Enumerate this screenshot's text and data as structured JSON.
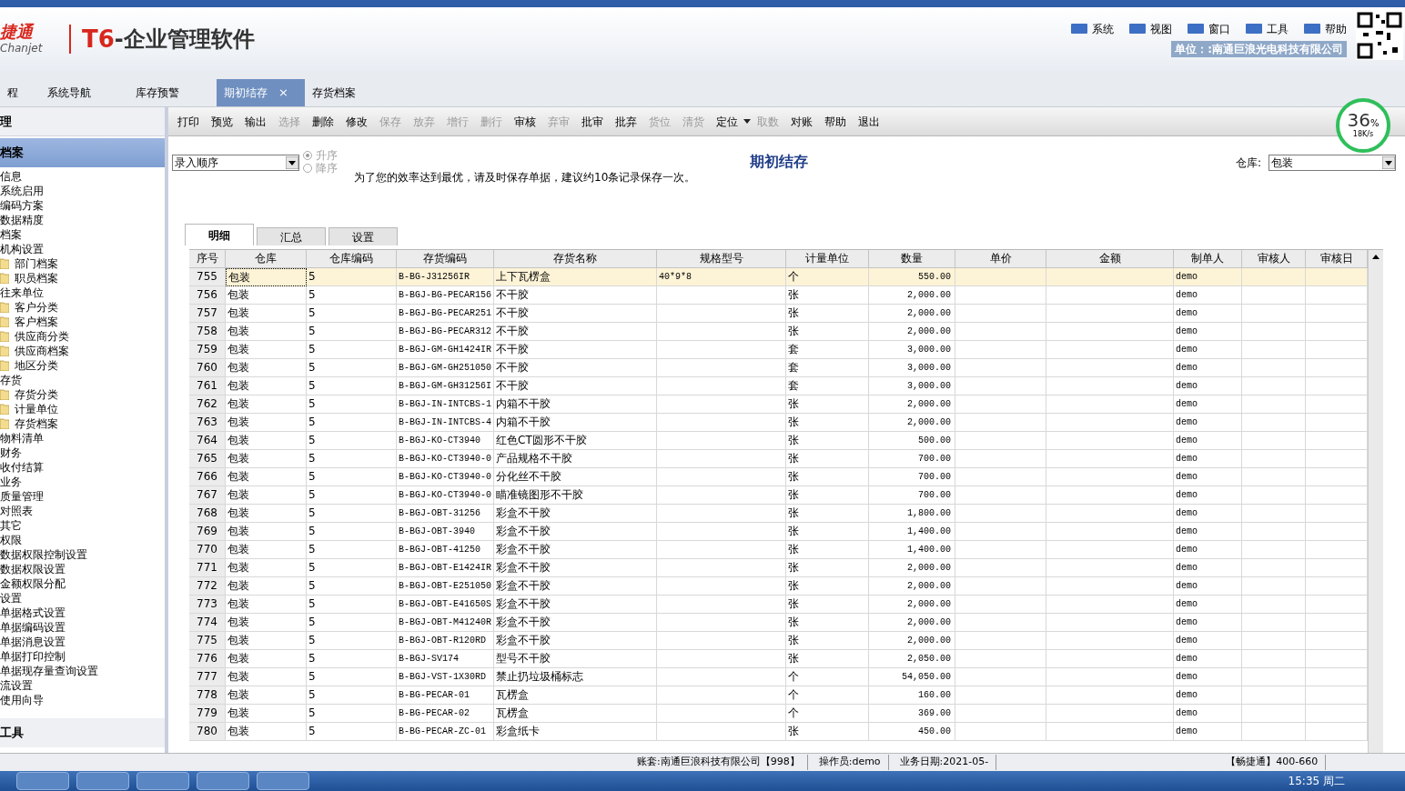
{
  "header": {
    "brand_cn": "捷通",
    "brand_en": "Chanjet",
    "product_mark": "T6",
    "product_title": "-企业管理软件",
    "menu": [
      "系统",
      "视图",
      "窗口",
      "工具",
      "帮助"
    ],
    "unit": "单位：:南通巨浪光电科技有限公司"
  },
  "tabs": [
    {
      "label": "程",
      "selected": false
    },
    {
      "label": "系统导航",
      "selected": false
    },
    {
      "label": "库存预警",
      "selected": false
    },
    {
      "label": "期初结存",
      "selected": true,
      "close": "×"
    },
    {
      "label": "存货档案",
      "selected": false
    }
  ],
  "sidebar": {
    "top": "理",
    "section": "档案",
    "bottom": "工具",
    "items": [
      {
        "label": "信息",
        "folder": false
      },
      {
        "label": "系统启用",
        "folder": false
      },
      {
        "label": "编码方案",
        "folder": false
      },
      {
        "label": "数据精度",
        "folder": false
      },
      {
        "label": "档案",
        "folder": false
      },
      {
        "label": "机构设置",
        "folder": false,
        "children": [
          {
            "label": "部门档案",
            "folder": true
          },
          {
            "label": "职员档案",
            "folder": true
          }
        ]
      },
      {
        "label": "往来单位",
        "folder": false,
        "children": [
          {
            "label": "客户分类",
            "folder": true
          },
          {
            "label": "客户档案",
            "folder": true
          },
          {
            "label": "供应商分类",
            "folder": true
          },
          {
            "label": "供应商档案",
            "folder": true
          },
          {
            "label": "地区分类",
            "folder": true
          }
        ]
      },
      {
        "label": "存货",
        "folder": false,
        "children": [
          {
            "label": "存货分类",
            "folder": true
          },
          {
            "label": "计量单位",
            "folder": true
          },
          {
            "label": "存货档案",
            "folder": true
          }
        ]
      },
      {
        "label": "物料清单",
        "folder": false
      },
      {
        "label": "财务",
        "folder": false
      },
      {
        "label": "收付结算",
        "folder": false
      },
      {
        "label": "业务",
        "folder": false
      },
      {
        "label": "质量管理",
        "folder": false
      },
      {
        "label": "对照表",
        "folder": false
      },
      {
        "label": "其它",
        "folder": false
      },
      {
        "label": "权限",
        "folder": false
      },
      {
        "label": "数据权限控制设置",
        "folder": false
      },
      {
        "label": "数据权限设置",
        "folder": false
      },
      {
        "label": "金额权限分配",
        "folder": false
      },
      {
        "label": "设置",
        "folder": false
      },
      {
        "label": "单据格式设置",
        "folder": false
      },
      {
        "label": "单据编码设置",
        "folder": false
      },
      {
        "label": "单据消息设置",
        "folder": false
      },
      {
        "label": "单据打印控制",
        "folder": false
      },
      {
        "label": "单据现存量查询设置",
        "folder": false
      },
      {
        "label": "流设置",
        "folder": false
      },
      {
        "label": "使用向导",
        "folder": false
      }
    ]
  },
  "toolbar": [
    {
      "label": "打印",
      "disabled": false
    },
    {
      "label": "预览",
      "disabled": false
    },
    {
      "label": "输出",
      "disabled": false
    },
    {
      "label": "选择",
      "disabled": true
    },
    {
      "label": "删除",
      "disabled": false
    },
    {
      "label": "修改",
      "disabled": false
    },
    {
      "label": "保存",
      "disabled": true
    },
    {
      "label": "放弃",
      "disabled": true
    },
    {
      "label": "增行",
      "disabled": true
    },
    {
      "label": "删行",
      "disabled": true
    },
    {
      "label": "审核",
      "disabled": false
    },
    {
      "label": "弃审",
      "disabled": true
    },
    {
      "label": "批审",
      "disabled": false
    },
    {
      "label": "批弃",
      "disabled": false
    },
    {
      "label": "货位",
      "disabled": true
    },
    {
      "label": "清货",
      "disabled": true
    },
    {
      "label": "定位",
      "disabled": false,
      "dropdown": true
    },
    {
      "label": "取数",
      "disabled": true
    },
    {
      "label": "对账",
      "disabled": false
    },
    {
      "label": "帮助",
      "disabled": false
    },
    {
      "label": "退出",
      "disabled": false
    }
  ],
  "network": {
    "percent": "36",
    "unit": "%",
    "speed": "18K/s"
  },
  "form": {
    "sort": "录入顺序",
    "order": [
      {
        "label": "升序",
        "selected": true
      },
      {
        "label": "降序",
        "selected": false
      }
    ],
    "hint": "为了您的效率达到最优，请及时保存单据，建议约10条记录保存一次。",
    "title": "期初结存",
    "warehouse_label": "仓库:",
    "warehouse": "包装"
  },
  "subtabs": [
    {
      "label": "明细",
      "selected": true
    },
    {
      "label": "汇总",
      "selected": false
    },
    {
      "label": "设置",
      "selected": false
    }
  ],
  "table": {
    "columns": [
      "序号",
      "仓库",
      "仓库编码",
      "存货编码",
      "存货名称",
      "规格型号",
      "计量单位",
      "数量",
      "单价",
      "金额",
      "制单人",
      "审核人",
      "审核日"
    ],
    "rows": [
      {
        "selected": true,
        "cells": [
          "755",
          "包装",
          "5",
          "B-BG-J31256IR",
          "上下瓦楞盒",
          "40*9*8",
          "个",
          "550.00",
          "",
          "",
          "demo",
          "",
          ""
        ]
      },
      {
        "selected": false,
        "cells": [
          "756",
          "包装",
          "5",
          "B-BGJ-BG-PECAR156",
          "不干胶",
          "",
          "张",
          "2,000.00",
          "",
          "",
          "demo",
          "",
          ""
        ]
      },
      {
        "selected": false,
        "cells": [
          "757",
          "包装",
          "5",
          "B-BGJ-BG-PECAR251",
          "不干胶",
          "",
          "张",
          "2,000.00",
          "",
          "",
          "demo",
          "",
          ""
        ]
      },
      {
        "selected": false,
        "cells": [
          "758",
          "包装",
          "5",
          "B-BGJ-BG-PECAR312",
          "不干胶",
          "",
          "张",
          "2,000.00",
          "",
          "",
          "demo",
          "",
          ""
        ]
      },
      {
        "selected": false,
        "cells": [
          "759",
          "包装",
          "5",
          "B-BGJ-GM-GH1424IR",
          "不干胶",
          "",
          "套",
          "3,000.00",
          "",
          "",
          "demo",
          "",
          ""
        ]
      },
      {
        "selected": false,
        "cells": [
          "760",
          "包装",
          "5",
          "B-BGJ-GM-GH251050",
          "不干胶",
          "",
          "套",
          "3,000.00",
          "",
          "",
          "demo",
          "",
          ""
        ]
      },
      {
        "selected": false,
        "cells": [
          "761",
          "包装",
          "5",
          "B-BGJ-GM-GH31256I",
          "不干胶",
          "",
          "套",
          "3,000.00",
          "",
          "",
          "demo",
          "",
          ""
        ]
      },
      {
        "selected": false,
        "cells": [
          "762",
          "包装",
          "5",
          "B-BGJ-IN-INTCBS-1",
          "内箱不干胶",
          "",
          "张",
          "2,000.00",
          "",
          "",
          "demo",
          "",
          ""
        ]
      },
      {
        "selected": false,
        "cells": [
          "763",
          "包装",
          "5",
          "B-BGJ-IN-INTCBS-4",
          "内箱不干胶",
          "",
          "张",
          "2,000.00",
          "",
          "",
          "demo",
          "",
          ""
        ]
      },
      {
        "selected": false,
        "cells": [
          "764",
          "包装",
          "5",
          "B-BGJ-KO-CT3940",
          "红色CT圆形不干胶",
          "",
          "张",
          "500.00",
          "",
          "",
          "demo",
          "",
          ""
        ]
      },
      {
        "selected": false,
        "cells": [
          "765",
          "包装",
          "5",
          "B-BGJ-KO-CT3940-0",
          "产品规格不干胶",
          "",
          "张",
          "700.00",
          "",
          "",
          "demo",
          "",
          ""
        ]
      },
      {
        "selected": false,
        "cells": [
          "766",
          "包装",
          "5",
          "B-BGJ-KO-CT3940-0",
          "分化丝不干胶",
          "",
          "张",
          "700.00",
          "",
          "",
          "demo",
          "",
          ""
        ]
      },
      {
        "selected": false,
        "cells": [
          "767",
          "包装",
          "5",
          "B-BGJ-KO-CT3940-0",
          "瞄准镜图形不干胶",
          "",
          "张",
          "700.00",
          "",
          "",
          "demo",
          "",
          ""
        ]
      },
      {
        "selected": false,
        "cells": [
          "768",
          "包装",
          "5",
          "B-BGJ-OBT-31256",
          "彩盒不干胶",
          "",
          "张",
          "1,800.00",
          "",
          "",
          "demo",
          "",
          ""
        ]
      },
      {
        "selected": false,
        "cells": [
          "769",
          "包装",
          "5",
          "B-BGJ-OBT-3940",
          "彩盒不干胶",
          "",
          "张",
          "1,400.00",
          "",
          "",
          "demo",
          "",
          ""
        ]
      },
      {
        "selected": false,
        "cells": [
          "770",
          "包装",
          "5",
          "B-BGJ-OBT-41250",
          "彩盒不干胶",
          "",
          "张",
          "1,400.00",
          "",
          "",
          "demo",
          "",
          ""
        ]
      },
      {
        "selected": false,
        "cells": [
          "771",
          "包装",
          "5",
          "B-BGJ-OBT-E1424IR",
          "彩盒不干胶",
          "",
          "张",
          "2,000.00",
          "",
          "",
          "demo",
          "",
          ""
        ]
      },
      {
        "selected": false,
        "cells": [
          "772",
          "包装",
          "5",
          "B-BGJ-OBT-E251050",
          "彩盒不干胶",
          "",
          "张",
          "2,000.00",
          "",
          "",
          "demo",
          "",
          ""
        ]
      },
      {
        "selected": false,
        "cells": [
          "773",
          "包装",
          "5",
          "B-BGJ-OBT-E41650S",
          "彩盒不干胶",
          "",
          "张",
          "2,000.00",
          "",
          "",
          "demo",
          "",
          ""
        ]
      },
      {
        "selected": false,
        "cells": [
          "774",
          "包装",
          "5",
          "B-BGJ-OBT-M41240R",
          "彩盒不干胶",
          "",
          "张",
          "2,000.00",
          "",
          "",
          "demo",
          "",
          ""
        ]
      },
      {
        "selected": false,
        "cells": [
          "775",
          "包装",
          "5",
          "B-BGJ-OBT-R120RD",
          "彩盒不干胶",
          "",
          "张",
          "2,000.00",
          "",
          "",
          "demo",
          "",
          ""
        ]
      },
      {
        "selected": false,
        "cells": [
          "776",
          "包装",
          "5",
          "B-BGJ-SV174",
          "型号不干胶",
          "",
          "张",
          "2,050.00",
          "",
          "",
          "demo",
          "",
          ""
        ]
      },
      {
        "selected": false,
        "cells": [
          "777",
          "包装",
          "5",
          "B-BGJ-VST-1X30RD",
          "禁止扔垃圾桶标志",
          "",
          "个",
          "54,050.00",
          "",
          "",
          "demo",
          "",
          ""
        ]
      },
      {
        "selected": false,
        "cells": [
          "778",
          "包装",
          "5",
          "B-BG-PECAR-01",
          "瓦楞盒",
          "",
          "个",
          "160.00",
          "",
          "",
          "demo",
          "",
          ""
        ]
      },
      {
        "selected": false,
        "cells": [
          "779",
          "包装",
          "5",
          "B-BG-PECAR-02",
          "瓦楞盒",
          "",
          "个",
          "369.00",
          "",
          "",
          "demo",
          "",
          ""
        ]
      },
      {
        "selected": false,
        "cells": [
          "780",
          "包装",
          "5",
          "B-BG-PECAR-ZC-01",
          "彩盒纸卡",
          "",
          "张",
          "450.00",
          "",
          "",
          "demo",
          "",
          ""
        ]
      }
    ]
  },
  "status_bar": [
    "账套:南通巨浪科技有限公司【998】",
    "操作员:demo",
    "业务日期:2021-05-",
    "【畅捷通】400-660"
  ],
  "taskbar": {
    "time": "15:35 周二"
  }
}
